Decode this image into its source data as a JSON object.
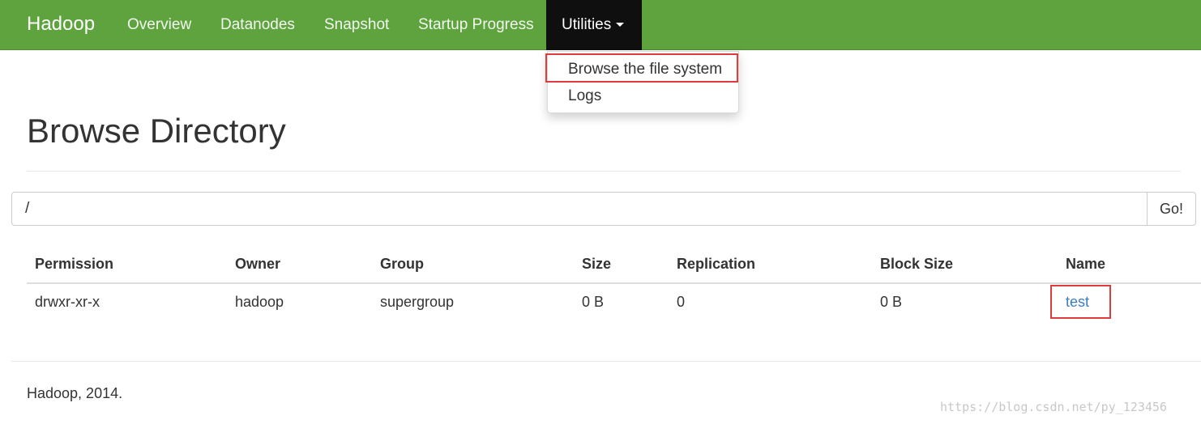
{
  "navbar": {
    "brand": "Hadoop",
    "items": [
      {
        "label": "Overview"
      },
      {
        "label": "Datanodes"
      },
      {
        "label": "Snapshot"
      },
      {
        "label": "Startup Progress"
      },
      {
        "label": "Utilities"
      }
    ],
    "accent_color": "#5fa33e",
    "active_color": "#0f0f0f"
  },
  "dropdown": {
    "items": [
      {
        "label": "Browse the file system",
        "highlighted": true
      },
      {
        "label": "Logs"
      }
    ]
  },
  "page": {
    "title": "Browse Directory"
  },
  "path_bar": {
    "value": "/",
    "go_label": "Go!"
  },
  "table": {
    "headers": [
      "Permission",
      "Owner",
      "Group",
      "Size",
      "Replication",
      "Block Size",
      "Name"
    ],
    "rows": [
      {
        "permission": "drwxr-xr-x",
        "owner": "hadoop",
        "group": "supergroup",
        "size": "0 B",
        "replication": "0",
        "block_size": "0 B",
        "name": "test",
        "name_highlighted": true
      }
    ]
  },
  "footer": {
    "text": "Hadoop, 2014."
  },
  "watermark": "https://blog.csdn.net/py_123456",
  "icons": {
    "dropdown_caret": "caret-down-icon"
  }
}
